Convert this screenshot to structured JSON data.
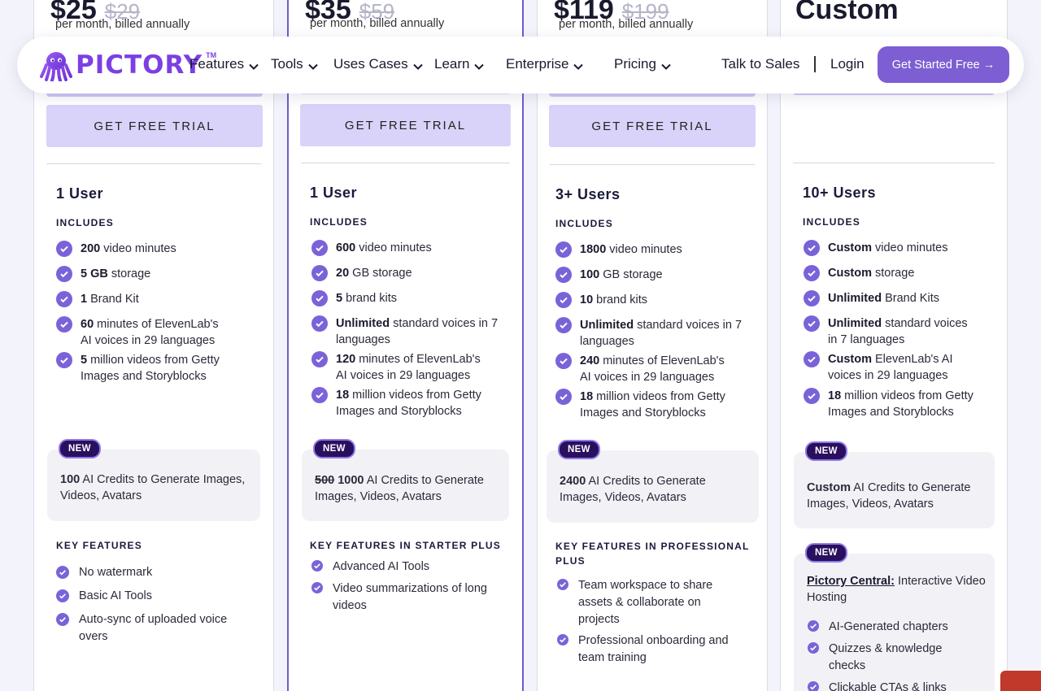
{
  "nav": {
    "logo": "PICTORY",
    "logo_tm": "TM",
    "items": [
      {
        "label": "Features"
      },
      {
        "label": "Tools"
      },
      {
        "label": "Uses Cases"
      },
      {
        "label": "Learn"
      },
      {
        "label": "Enterprise"
      },
      {
        "label": "Pricing"
      }
    ],
    "talk_to_sales": "Talk to Sales",
    "login": "Login",
    "cta": "Get Started Free →"
  },
  "plans": [
    {
      "price_now": "$25",
      "price_was": "$29",
      "billing": "per month, billed annually",
      "cta": "GET FREE TRIAL",
      "users": "1 User",
      "includes": "INCLUDES",
      "features": [
        {
          "b": "200",
          "t": " video minutes"
        },
        {
          "b": "5 GB",
          "t": " storage"
        },
        {
          "b": "1",
          "t": " Brand Kit"
        },
        {
          "b": "60",
          "t": " minutes of ElevenLab's AI voices in 29 languages"
        },
        {
          "b": "5",
          "t": " million videos from Getty Images and Storyblocks"
        }
      ],
      "new_badge": "NEW",
      "credits": {
        "b": "100",
        "t": " AI Credits to Generate Images, Videos, Avatars"
      },
      "kf_title": "KEY FEATURES",
      "key_features": [
        "No watermark",
        "Basic AI Tools",
        "Auto-sync of uploaded voice overs"
      ]
    },
    {
      "price_now": "$35",
      "price_was": "$59",
      "billing": "per month, billed annually",
      "cta": "GET FREE TRIAL",
      "users": "1 User",
      "includes": "INCLUDES",
      "features": [
        {
          "b": "600",
          "t": " video minutes"
        },
        {
          "b": "20",
          "t": " GB storage"
        },
        {
          "b": "5",
          "t": " brand kits"
        },
        {
          "b": "Unlimited",
          "t": " standard voices in 7 languages"
        },
        {
          "b": "120",
          "t": " minutes of ElevenLab's AI voices in 29 languages"
        },
        {
          "b": "18",
          "t": " million videos from Getty Images and Storyblocks"
        }
      ],
      "new_badge": "NEW",
      "credits": {
        "s": "500",
        "b": "1000",
        "t": " AI Credits to Generate Images, Videos, Avatars"
      },
      "kf_title": "KEY FEATURES IN STARTER PLUS",
      "key_features": [
        "Advanced AI Tools",
        "Video summarizations of long videos"
      ]
    },
    {
      "price_now": "$119",
      "price_was": "$199",
      "billing": "per month, billed annually",
      "cta": "GET FREE TRIAL",
      "users": "3+ Users",
      "includes": "INCLUDES",
      "features": [
        {
          "b": "1800",
          "t": " video minutes"
        },
        {
          "b": "100",
          "t": " GB storage"
        },
        {
          "b": "10",
          "t": " brand kits"
        },
        {
          "b": "Unlimited",
          "t": " standard voices in 7 languages"
        },
        {
          "b": "240",
          "t": " minutes of ElevenLab's AI voices in 29 languages"
        },
        {
          "b": "18",
          "t": " million videos from Getty Images and Storyblocks"
        }
      ],
      "new_badge": "NEW",
      "credits": {
        "b": "2400",
        "t": " AI Credits to Generate Images, Videos, Avatars"
      },
      "kf_title": "KEY FEATURES IN PROFESSIONAL PLUS",
      "key_features": [
        "Team workspace to share assets & collaborate on projects",
        "Professional onboarding and team training"
      ]
    },
    {
      "price_now": "Custom",
      "users": "10+ Users",
      "includes": "INCLUDES",
      "features": [
        {
          "b": "Custom",
          "t": " video minutes"
        },
        {
          "b": "Custom",
          "t": " storage"
        },
        {
          "b": "Unlimited",
          "t": " Brand Kits"
        },
        {
          "b": "Unlimited",
          "t": " standard voices in 7 languages"
        },
        {
          "b": "Custom",
          "t": " ElevenLab's AI voices in 29 languages"
        },
        {
          "b": "18",
          "t": " million videos from Getty Images and Storyblocks"
        }
      ],
      "new_badge": "NEW",
      "credits": {
        "b": "Custom",
        "t": " AI Credits to Generate Images, Videos, Avatars"
      },
      "new_badge_2": "NEW",
      "central": {
        "link": "Pictory Central:",
        "t": " Interactive Video Hosting"
      },
      "central_features": [
        "AI-Generated chapters",
        "Quizzes & knowledge checks",
        "Clickable CTAs & links"
      ]
    }
  ],
  "colors": {
    "accent": "#7d5fd3",
    "check": "#7a63d8",
    "badge": "#2a0f5e"
  }
}
